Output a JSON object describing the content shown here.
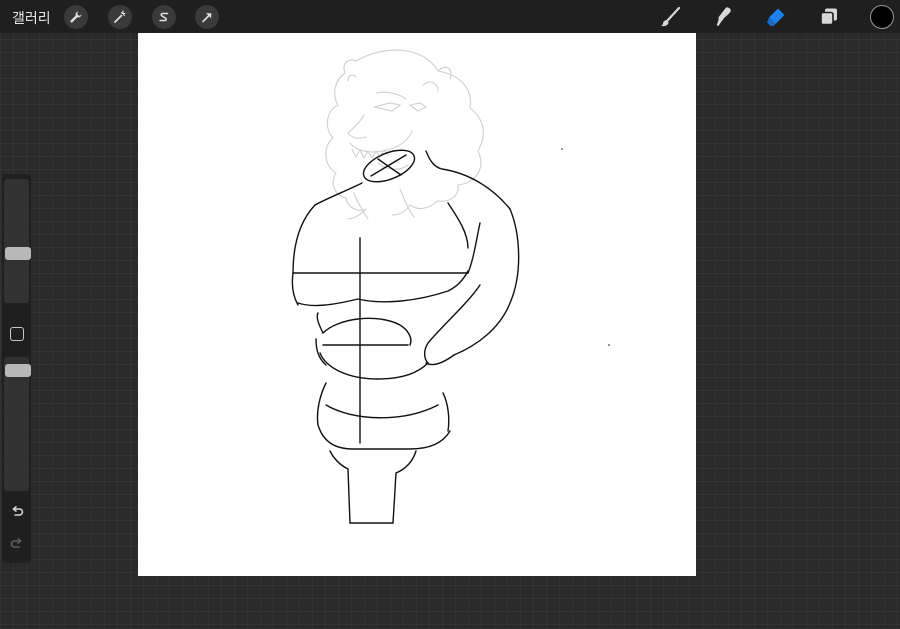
{
  "header": {
    "gallery_label": "갤러리"
  },
  "toolbar": {
    "left_icons": [
      "wrench-icon",
      "magic-wand-icon",
      "selection-s-icon",
      "transform-arrow-icon"
    ],
    "right_tools": [
      "brush-icon",
      "smudge-icon",
      "eraser-icon",
      "layers-icon"
    ],
    "active_tool": "eraser",
    "active_color": "#000000"
  },
  "sidebar": {
    "brush_size_level": 0.4,
    "opacity_level": 0.95
  },
  "colors": {
    "accent": "#1e7ff0",
    "background": "#2a2a2a",
    "canvas": "#ffffff"
  }
}
